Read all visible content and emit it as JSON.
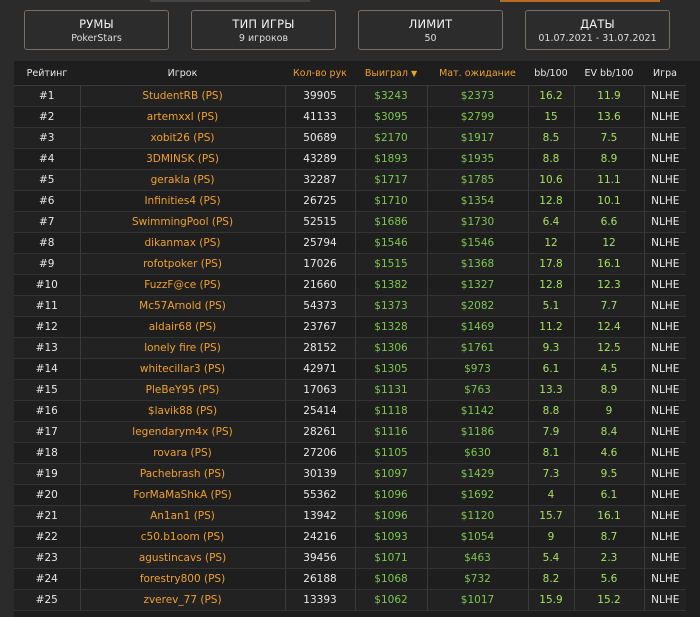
{
  "filters": [
    {
      "title": "РУМЫ",
      "value": "PokerStars"
    },
    {
      "title": "ТИП ИГРЫ",
      "value": "9 игроков"
    },
    {
      "title": "ЛИМИТ",
      "value": "50"
    },
    {
      "title": "ДАТЫ",
      "value": "01.07.2021 - 31.07.2021"
    }
  ],
  "table": {
    "headers": {
      "rank": "Рейтинг",
      "player": "Игрок",
      "hands": "Кол-во рук",
      "won": "Выиграл",
      "won_arrow": "▼",
      "ev": "Мат. ожидание",
      "bb100": "bb/100",
      "evbb100": "EV bb/100",
      "game": "Игра"
    },
    "rows": [
      [
        "#1",
        "StudentRB (PS)",
        "39905",
        "$3243",
        "$2373",
        "16.2",
        "11.9",
        "NLHE"
      ],
      [
        "#2",
        "artemxxl (PS)",
        "41133",
        "$3095",
        "$2799",
        "15",
        "13.6",
        "NLHE"
      ],
      [
        "#3",
        "xobit26 (PS)",
        "50689",
        "$2170",
        "$1917",
        "8.5",
        "7.5",
        "NLHE"
      ],
      [
        "#4",
        "3DMINSK (PS)",
        "43289",
        "$1893",
        "$1935",
        "8.8",
        "8.9",
        "NLHE"
      ],
      [
        "#5",
        "gerakla (PS)",
        "32287",
        "$1717",
        "$1785",
        "10.6",
        "11.1",
        "NLHE"
      ],
      [
        "#6",
        "Infinities4 (PS)",
        "26725",
        "$1710",
        "$1354",
        "12.8",
        "10.1",
        "NLHE"
      ],
      [
        "#7",
        "SwimmingPool (PS)",
        "52515",
        "$1686",
        "$1730",
        "6.4",
        "6.6",
        "NLHE"
      ],
      [
        "#8",
        "dikanmax (PS)",
        "25794",
        "$1546",
        "$1546",
        "12",
        "12",
        "NLHE"
      ],
      [
        "#9",
        "rofotpoker (PS)",
        "17026",
        "$1515",
        "$1368",
        "17.8",
        "16.1",
        "NLHE"
      ],
      [
        "#10",
        "FuzzF@ce (PS)",
        "21660",
        "$1382",
        "$1327",
        "12.8",
        "12.3",
        "NLHE"
      ],
      [
        "#11",
        "Mc57Arnold (PS)",
        "54373",
        "$1373",
        "$2082",
        "5.1",
        "7.7",
        "NLHE"
      ],
      [
        "#12",
        "aldair68 (PS)",
        "23767",
        "$1328",
        "$1469",
        "11.2",
        "12.4",
        "NLHE"
      ],
      [
        "#13",
        "lonely fire (PS)",
        "28152",
        "$1306",
        "$1761",
        "9.3",
        "12.5",
        "NLHE"
      ],
      [
        "#14",
        "whitecillar3 (PS)",
        "42971",
        "$1305",
        "$973",
        "6.1",
        "4.5",
        "NLHE"
      ],
      [
        "#15",
        "PleBeY95 (PS)",
        "17063",
        "$1131",
        "$763",
        "13.3",
        "8.9",
        "NLHE"
      ],
      [
        "#16",
        "$lavik88 (PS)",
        "25414",
        "$1118",
        "$1142",
        "8.8",
        "9",
        "NLHE"
      ],
      [
        "#17",
        "legendarym4x (PS)",
        "28261",
        "$1116",
        "$1186",
        "7.9",
        "8.4",
        "NLHE"
      ],
      [
        "#18",
        "rovara (PS)",
        "27206",
        "$1105",
        "$630",
        "8.1",
        "4.6",
        "NLHE"
      ],
      [
        "#19",
        "Pachebrash (PS)",
        "30139",
        "$1097",
        "$1429",
        "7.3",
        "9.5",
        "NLHE"
      ],
      [
        "#20",
        "ForMaMaShkA (PS)",
        "55362",
        "$1096",
        "$1692",
        "4",
        "6.1",
        "NLHE"
      ],
      [
        "#21",
        "An1an1 (PS)",
        "13942",
        "$1096",
        "$1120",
        "15.7",
        "16.1",
        "NLHE"
      ],
      [
        "#22",
        "c50.b1oom (PS)",
        "24216",
        "$1093",
        "$1054",
        "9",
        "8.7",
        "NLHE"
      ],
      [
        "#23",
        "agustincavs (PS)",
        "39456",
        "$1071",
        "$463",
        "5.4",
        "2.3",
        "NLHE"
      ],
      [
        "#24",
        "forestry800 (PS)",
        "26188",
        "$1068",
        "$732",
        "8.2",
        "5.6",
        "NLHE"
      ],
      [
        "#25",
        "zverev_77 (PS)",
        "13393",
        "$1062",
        "$1017",
        "15.9",
        "15.2",
        "NLHE"
      ]
    ]
  },
  "colors": {
    "accent": "#f0a030",
    "money": "#7ec850",
    "bb": "#a6e060"
  }
}
